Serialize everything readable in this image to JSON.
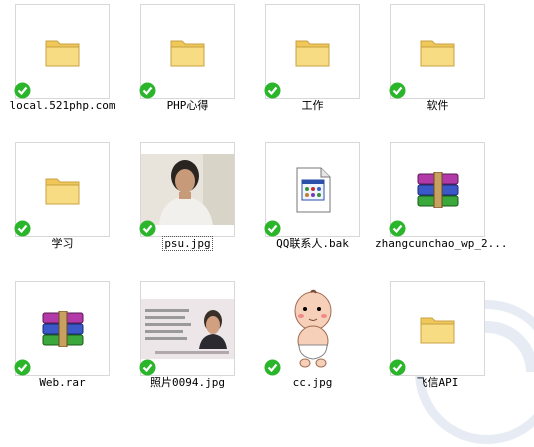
{
  "items": [
    {
      "label": "local.521php.com",
      "icon": "folder-icon"
    },
    {
      "label": "PHP心得",
      "icon": "folder-icon"
    },
    {
      "label": "工作",
      "icon": "folder-icon"
    },
    {
      "label": "软件",
      "icon": "folder-icon"
    },
    {
      "label": "学习",
      "icon": "folder-icon"
    },
    {
      "label": "psu.jpg",
      "icon": "photo-thumbnail"
    },
    {
      "label": "QQ联系人.bak",
      "icon": "bak-file-icon"
    },
    {
      "label": "zhangcunchao_wp_2...",
      "icon": "winrar-archive-icon"
    },
    {
      "label": "Web.rar",
      "icon": "winrar-archive-icon"
    },
    {
      "label": "照片0094.jpg",
      "icon": "photo-thumbnail"
    },
    {
      "label": "cc.jpg",
      "icon": "cartoon-thumbnail"
    },
    {
      "label": "飞信API",
      "icon": "folder-icon"
    }
  ],
  "colors": {
    "check": "#2bb52b",
    "folder": "#f4d46e"
  }
}
